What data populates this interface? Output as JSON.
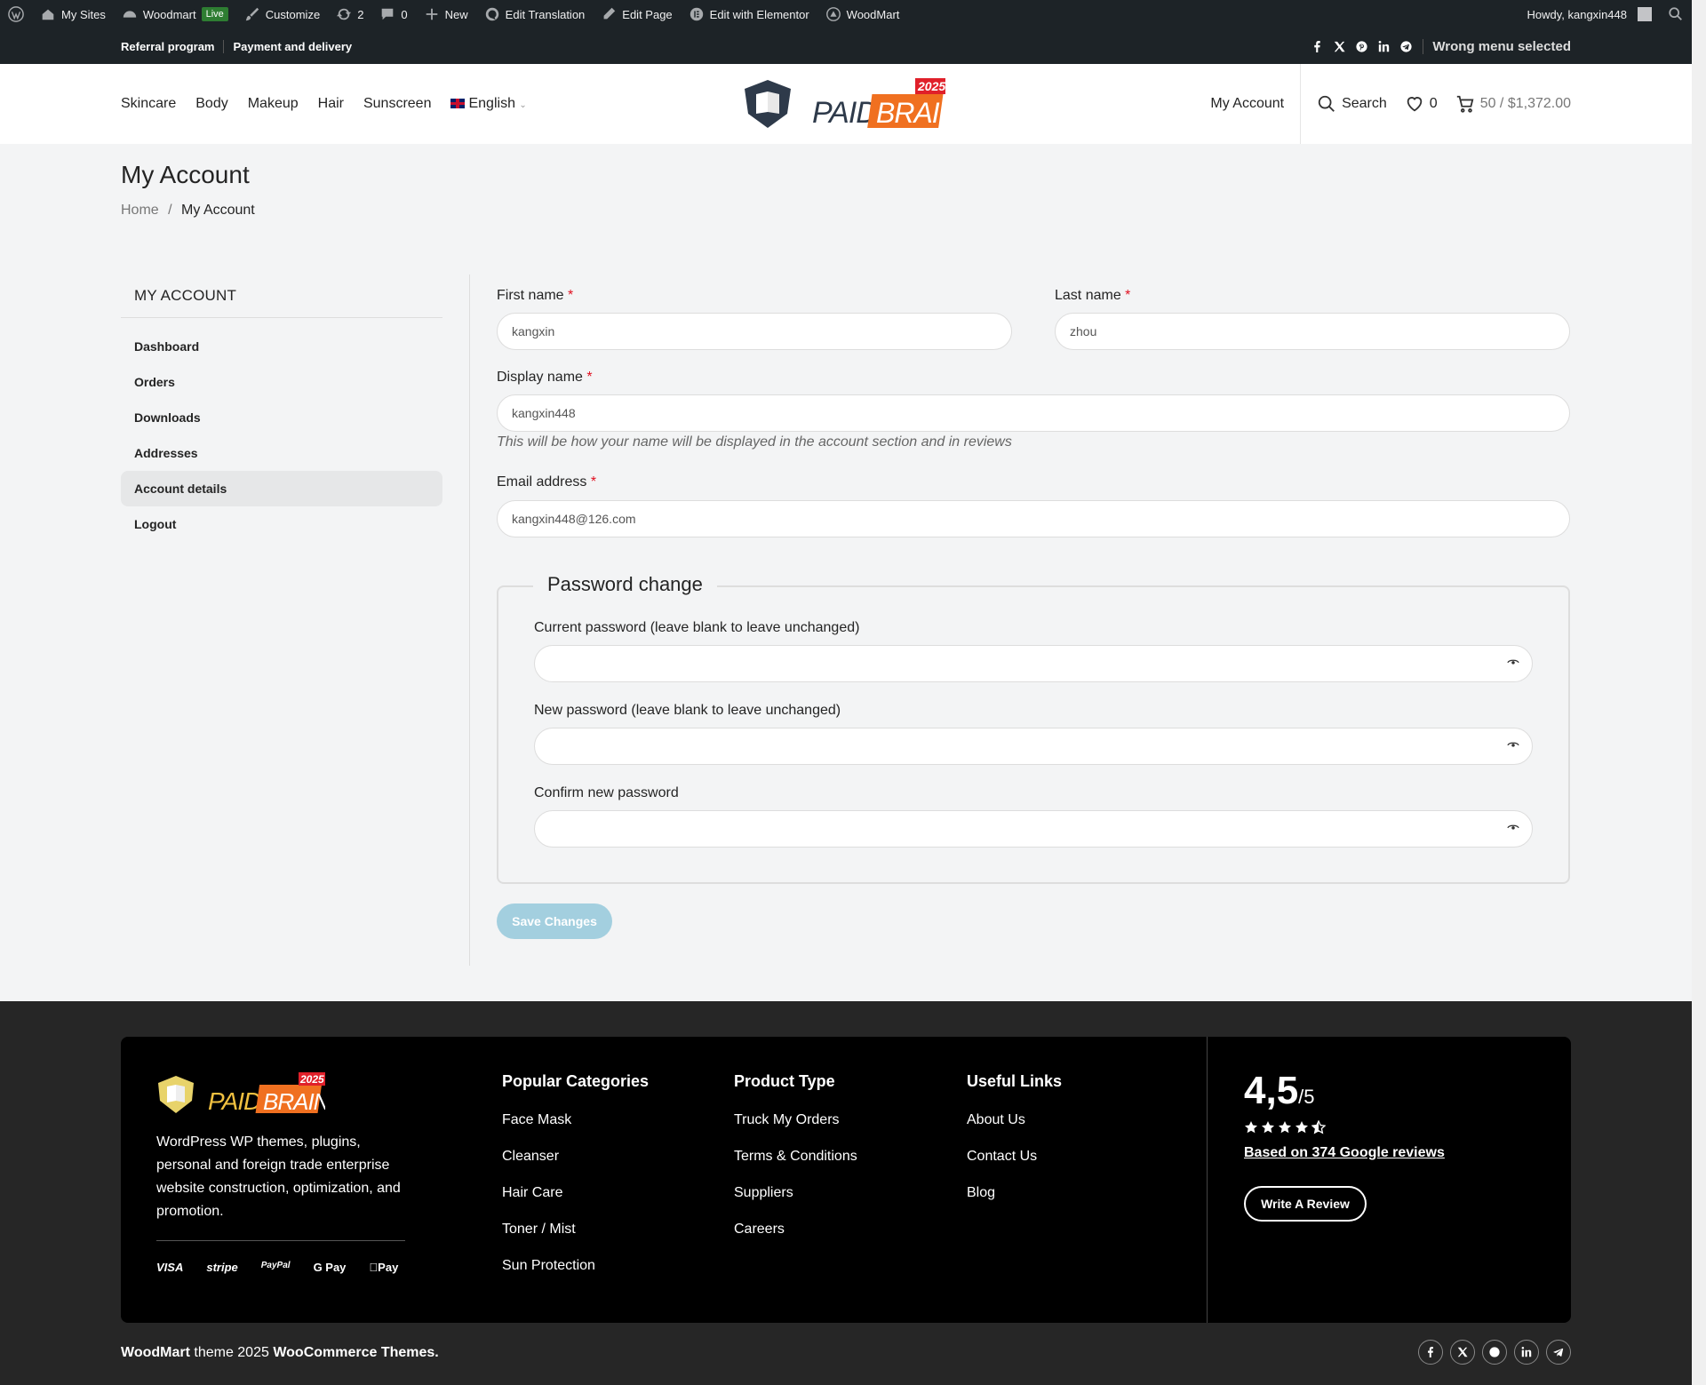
{
  "adminbar": {
    "my_sites": "My Sites",
    "site_name": "Woodmart",
    "live_badge": "Live",
    "customize": "Customize",
    "updates": "2",
    "comments": "0",
    "new": "New",
    "edit_translation": "Edit Translation",
    "edit_page": "Edit Page",
    "edit_elementor": "Edit with Elementor",
    "woodmart": "WoodMart",
    "howdy": "Howdy, kangxin448"
  },
  "topbar": {
    "referral": "Referral program",
    "payment": "Payment and delivery",
    "wrong_menu": "Wrong menu selected"
  },
  "header": {
    "nav": [
      "Skincare",
      "Body",
      "Makeup",
      "Hair",
      "Sunscreen"
    ],
    "language": "English",
    "logo_text": "PAIDBRAINY",
    "logo_year": "2025",
    "my_account": "My Account",
    "search": "Search",
    "wishlist_count": "0",
    "cart": "50 / $1,372.00"
  },
  "page": {
    "title": "My Account",
    "breadcrumb_home": "Home",
    "breadcrumb_sep": "/",
    "breadcrumb_current": "My Account"
  },
  "sidebar": {
    "heading": "MY ACCOUNT",
    "items": [
      "Dashboard",
      "Orders",
      "Downloads",
      "Addresses",
      "Account details",
      "Logout"
    ]
  },
  "form": {
    "first_name_label": "First name",
    "first_name_value": "kangxin",
    "last_name_label": "Last name",
    "last_name_value": "zhou",
    "display_name_label": "Display name",
    "display_name_value": "kangxin448",
    "display_hint": "This will be how your name will be displayed in the account section and in reviews",
    "email_label": "Email address",
    "email_value": "kangxin448@126.com",
    "required_mark": "*",
    "password_legend": "Password change",
    "current_pw_label": "Current password (leave blank to leave unchanged)",
    "new_pw_label": "New password (leave blank to leave unchanged)",
    "confirm_pw_label": "Confirm new password",
    "save_label": "Save Changes"
  },
  "footer": {
    "description": "WordPress WP themes, plugins, personal and foreign trade enterprise website construction, optimization, and promotion.",
    "payments": [
      "VISA",
      "stripe",
      "PayPal",
      "G Pay",
      "Pay"
    ],
    "col1_title": "Popular Categories",
    "col1": [
      "Face Mask",
      "Cleanser",
      "Hair Care",
      "Toner / Mist",
      "Sun Protection"
    ],
    "col2_title": "Product Type",
    "col2": [
      "Truck My Orders",
      "Terms & Conditions",
      "Suppliers",
      "Careers"
    ],
    "col3_title": "Useful Links",
    "col3": [
      "About Us",
      "Contact Us",
      "Blog"
    ],
    "rating_value": "4,5",
    "rating_max": "/5",
    "rating_stars": 4.5,
    "reviews_link": "Based on 374 Google reviews",
    "write_review": "Write A Review",
    "copy_brand": "WoodMart",
    "copy_mid": " theme 2025 ",
    "copy_end": "WooCommerce Themes."
  },
  "colors": {
    "accent_save": "#a3cfdf",
    "admin_bg": "#1d2327",
    "footer_bg": "#000000",
    "logo_orange": "#f07020"
  }
}
